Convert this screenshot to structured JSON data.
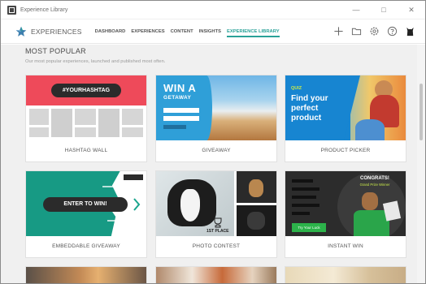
{
  "window": {
    "title": "Experience Library"
  },
  "nav": {
    "brand": "EXPERIENCES",
    "links": [
      "DASHBOARD",
      "EXPERIENCES",
      "CONTENT",
      "INSIGHTS",
      "EXPERIENCE LIBRARY"
    ],
    "active": "EXPERIENCE LIBRARY",
    "accent": "#2aa198"
  },
  "section": {
    "title": "MOST POPULAR",
    "subtitle": "Our most popular experiences, launched and published most often."
  },
  "cards": [
    {
      "label": "HASHTAG WALL",
      "thumb_text": "#YOURHASHTAG"
    },
    {
      "label": "GIVEAWAY",
      "thumb_text": "WIN A",
      "thumb_text2": "GETAWAY"
    },
    {
      "label": "PRODUCT PICKER",
      "thumb_tag": "QUIZ",
      "thumb_lines": [
        "Find your",
        "perfect",
        "product"
      ]
    },
    {
      "label": "EMBEDDABLE GIVEAWAY",
      "thumb_text": "ENTER TO WIN!"
    },
    {
      "label": "PHOTO CONTEST",
      "thumb_text": "1ST PLACE"
    },
    {
      "label": "INSTANT WIN",
      "thumb_text": "CONGRATS!",
      "thumb_text2": "Grand Prize Winner",
      "thumb_button": "Try Your Luck"
    }
  ]
}
